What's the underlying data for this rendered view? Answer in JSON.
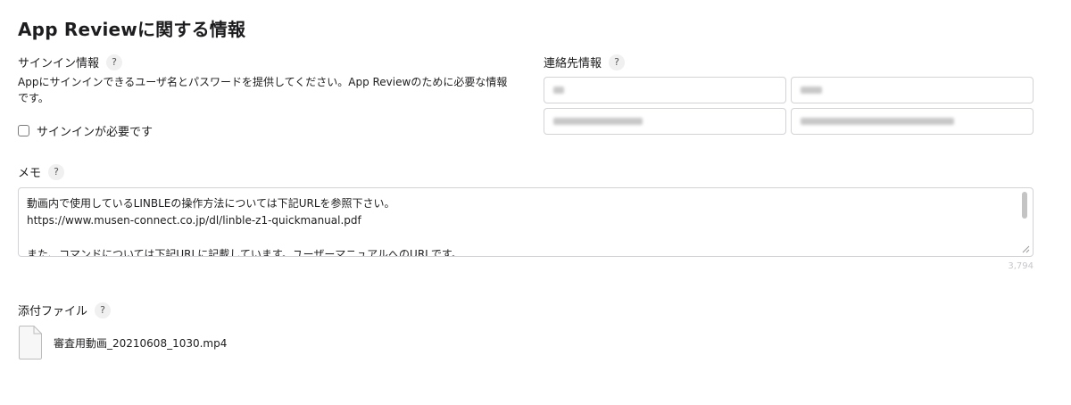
{
  "page": {
    "title": "App Reviewに関する情報"
  },
  "signin": {
    "label": "サインイン情報",
    "help": "?",
    "description": "Appにサインインできるユーザ名とパスワードを提供してください。App Reviewのために必要な情報です。",
    "checkbox_label": "サインインが必要です",
    "checkbox_checked": false
  },
  "contact": {
    "label": "連絡先情報",
    "help": "?"
  },
  "memo": {
    "label": "メモ",
    "help": "?",
    "lines": [
      "動画内で使用しているLINBLEの操作方法については下記URLを参照下さい。",
      "https://www.musen-connect.co.jp/dl/linble-z1-quickmanual.pdf",
      "",
      "また、コマンドについては下記URLに記載しています。ユーザーマニュアルへのURLです。"
    ],
    "char_count": "3,794"
  },
  "attachments": {
    "label": "添付ファイル",
    "help": "?",
    "files": [
      {
        "name": "審査用動画_20210608_1030.mp4",
        "icon": "file-icon"
      }
    ]
  },
  "colors": {
    "text": "#1d1d1f",
    "border": "#d2d2d7",
    "muted": "#c7c7cc"
  }
}
